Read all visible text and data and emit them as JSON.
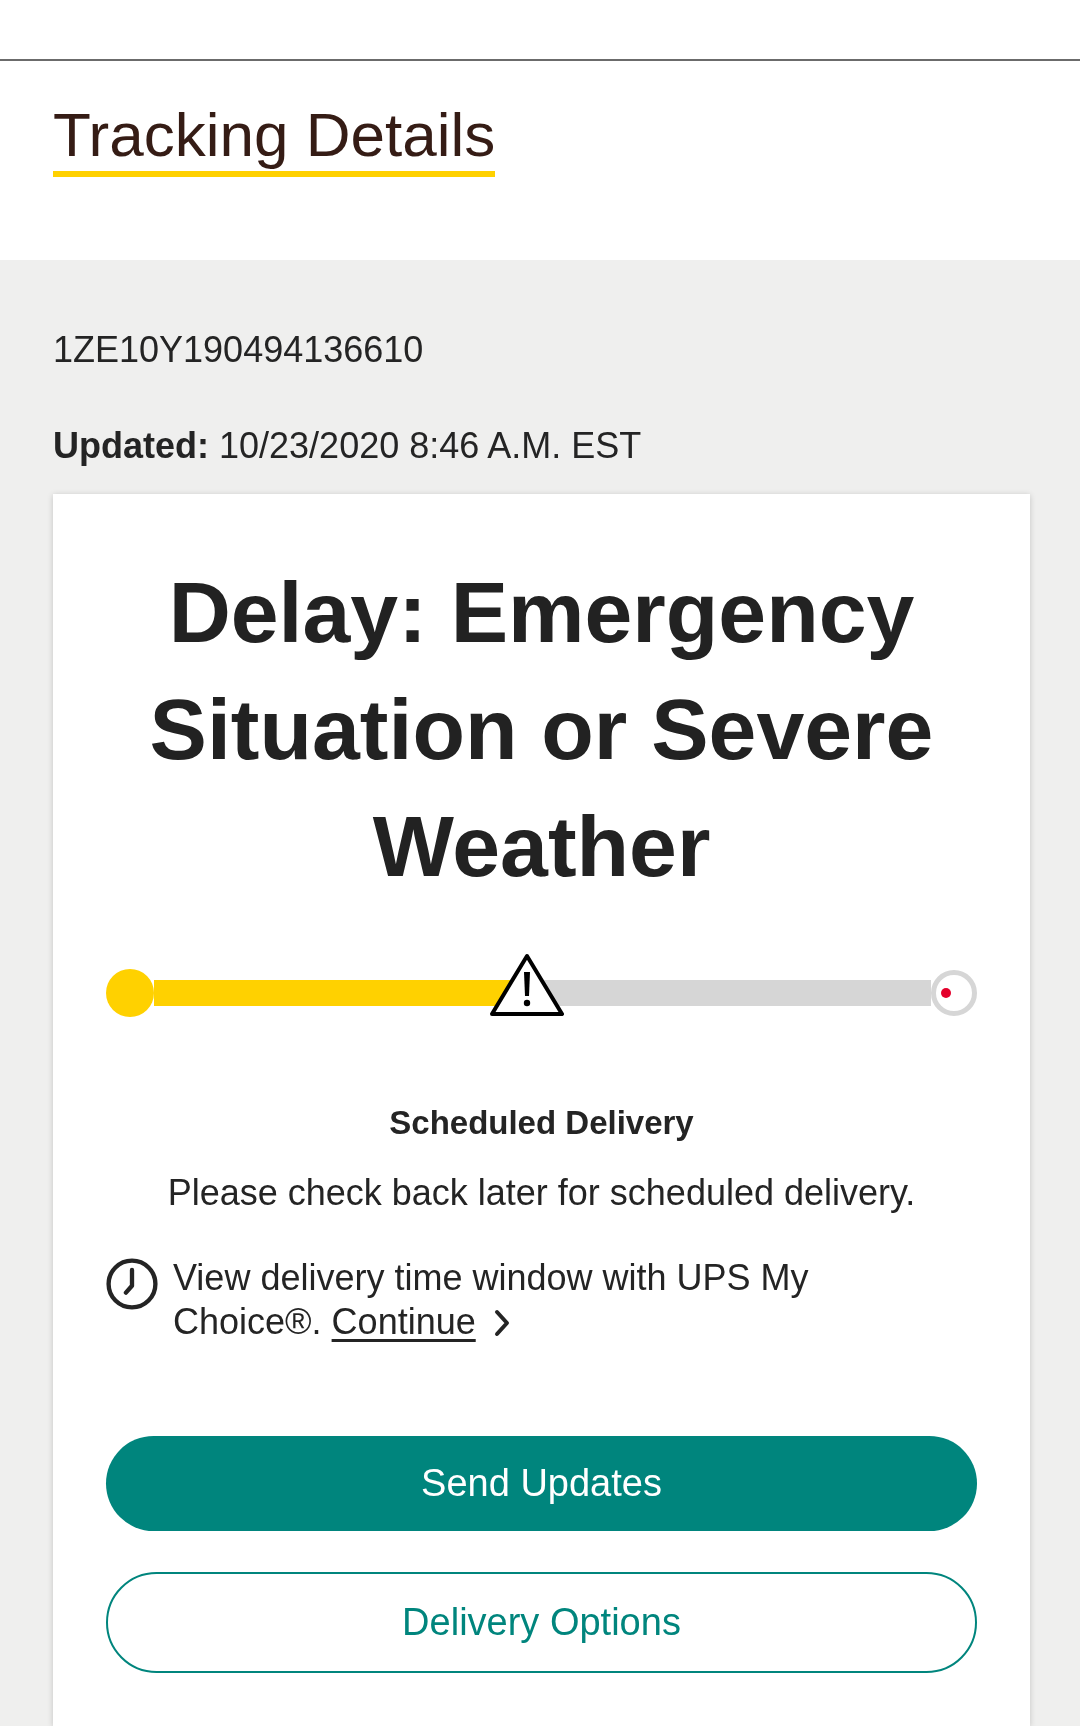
{
  "header": {
    "title": "Tracking Details"
  },
  "tracking": {
    "number": "1ZE10Y190494136610",
    "updated_label": "Updated:",
    "updated_value": "10/23/2020 8:46 A.M. EST"
  },
  "status_card": {
    "headline": "Delay: Emergency Situation or Severe Weather",
    "progress": {
      "level": 0.48,
      "alert": true
    },
    "scheduled_delivery": {
      "heading": "Scheduled Delivery",
      "message": "Please check back later for scheduled delivery."
    },
    "my_choice": {
      "text": "View delivery time window with UPS My Choice®.",
      "link": "Continue"
    },
    "buttons": [
      {
        "label": "Send Updates",
        "kind": "primary"
      },
      {
        "label": "Delivery Options",
        "kind": "outline"
      }
    ]
  }
}
